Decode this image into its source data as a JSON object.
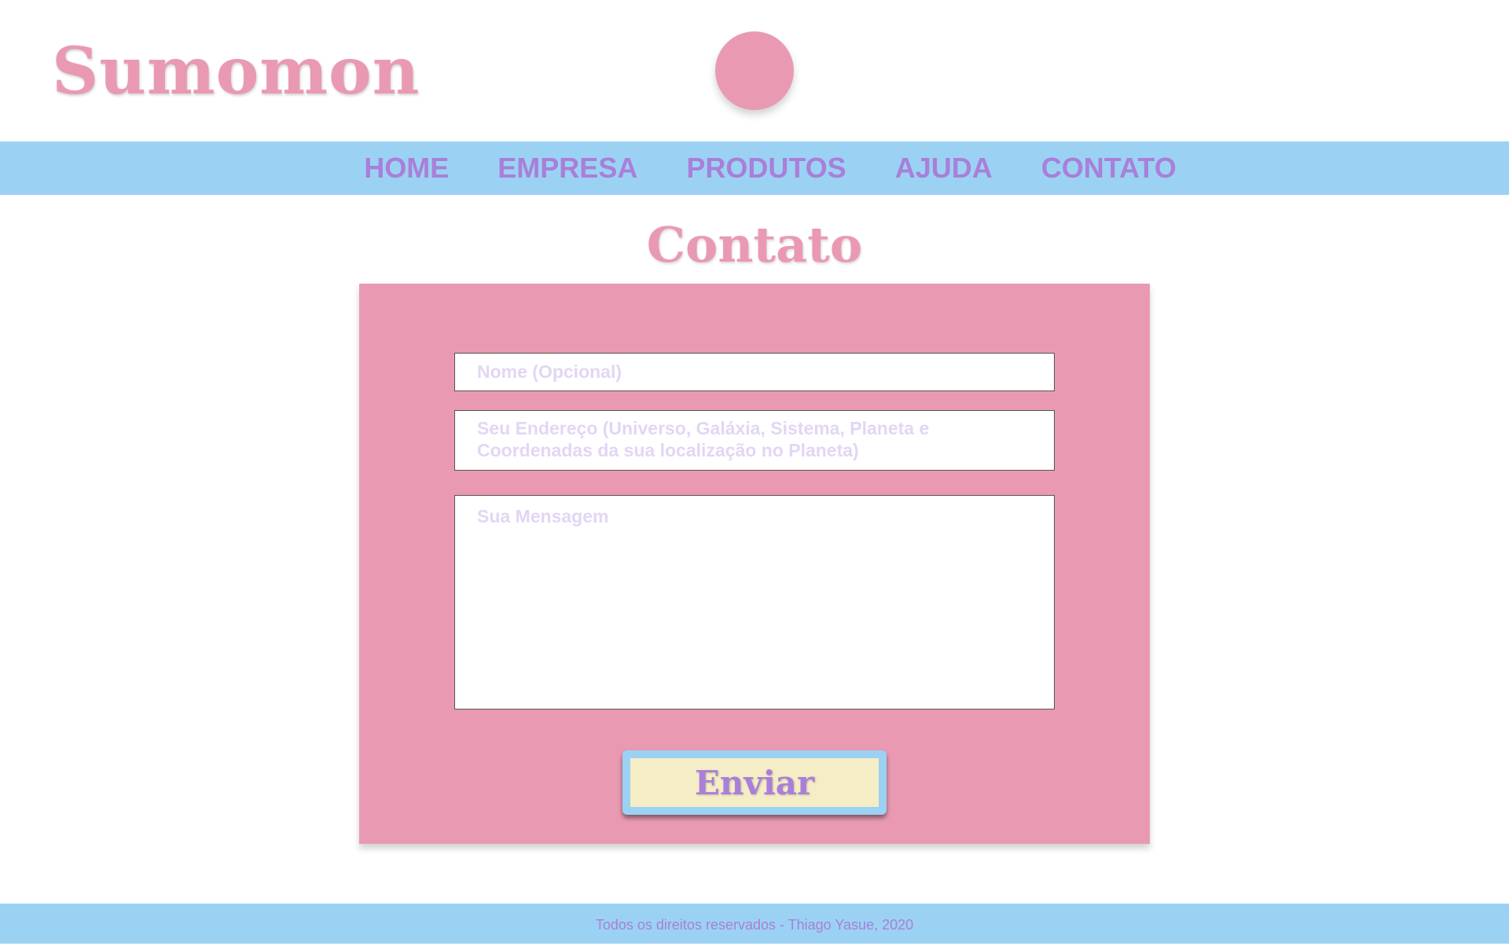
{
  "header": {
    "logo": "Sumomon"
  },
  "nav": {
    "items": [
      {
        "label": "HOME"
      },
      {
        "label": "EMPRESA"
      },
      {
        "label": "PRODUTOS"
      },
      {
        "label": "AJUDA"
      },
      {
        "label": "CONTATO"
      }
    ]
  },
  "page": {
    "title": "Contato"
  },
  "form": {
    "name_placeholder": "Nome (Opcional)",
    "address_placeholder": "Seu Endereço (Universo, Galáxia, Sistema, Planeta e Coordenadas da sua localização no Planeta)",
    "message_placeholder": "Sua Mensagem",
    "submit_label": "Enviar"
  },
  "footer": {
    "text": "Todos os direitos reservados - Thiago Yasue, 2020"
  },
  "colors": {
    "pink": "#e99ab2",
    "sky": "#9bd2f3",
    "lavender": "#a97fd9",
    "cream": "#f5edc6"
  }
}
